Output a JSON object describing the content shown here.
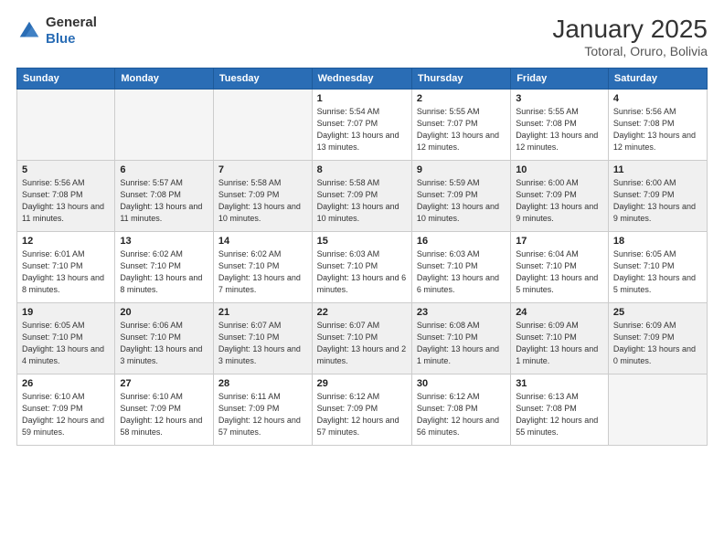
{
  "logo": {
    "general": "General",
    "blue": "Blue"
  },
  "header": {
    "month": "January 2025",
    "location": "Totoral, Oruro, Bolivia"
  },
  "weekdays": [
    "Sunday",
    "Monday",
    "Tuesday",
    "Wednesday",
    "Thursday",
    "Friday",
    "Saturday"
  ],
  "weeks": [
    [
      {
        "day": "",
        "text": ""
      },
      {
        "day": "",
        "text": ""
      },
      {
        "day": "",
        "text": ""
      },
      {
        "day": "1",
        "text": "Sunrise: 5:54 AM\nSunset: 7:07 PM\nDaylight: 13 hours\nand 13 minutes."
      },
      {
        "day": "2",
        "text": "Sunrise: 5:55 AM\nSunset: 7:07 PM\nDaylight: 13 hours\nand 12 minutes."
      },
      {
        "day": "3",
        "text": "Sunrise: 5:55 AM\nSunset: 7:08 PM\nDaylight: 13 hours\nand 12 minutes."
      },
      {
        "day": "4",
        "text": "Sunrise: 5:56 AM\nSunset: 7:08 PM\nDaylight: 13 hours\nand 12 minutes."
      }
    ],
    [
      {
        "day": "5",
        "text": "Sunrise: 5:56 AM\nSunset: 7:08 PM\nDaylight: 13 hours\nand 11 minutes."
      },
      {
        "day": "6",
        "text": "Sunrise: 5:57 AM\nSunset: 7:08 PM\nDaylight: 13 hours\nand 11 minutes."
      },
      {
        "day": "7",
        "text": "Sunrise: 5:58 AM\nSunset: 7:09 PM\nDaylight: 13 hours\nand 10 minutes."
      },
      {
        "day": "8",
        "text": "Sunrise: 5:58 AM\nSunset: 7:09 PM\nDaylight: 13 hours\nand 10 minutes."
      },
      {
        "day": "9",
        "text": "Sunrise: 5:59 AM\nSunset: 7:09 PM\nDaylight: 13 hours\nand 10 minutes."
      },
      {
        "day": "10",
        "text": "Sunrise: 6:00 AM\nSunset: 7:09 PM\nDaylight: 13 hours\nand 9 minutes."
      },
      {
        "day": "11",
        "text": "Sunrise: 6:00 AM\nSunset: 7:09 PM\nDaylight: 13 hours\nand 9 minutes."
      }
    ],
    [
      {
        "day": "12",
        "text": "Sunrise: 6:01 AM\nSunset: 7:10 PM\nDaylight: 13 hours\nand 8 minutes."
      },
      {
        "day": "13",
        "text": "Sunrise: 6:02 AM\nSunset: 7:10 PM\nDaylight: 13 hours\nand 8 minutes."
      },
      {
        "day": "14",
        "text": "Sunrise: 6:02 AM\nSunset: 7:10 PM\nDaylight: 13 hours\nand 7 minutes."
      },
      {
        "day": "15",
        "text": "Sunrise: 6:03 AM\nSunset: 7:10 PM\nDaylight: 13 hours\nand 6 minutes."
      },
      {
        "day": "16",
        "text": "Sunrise: 6:03 AM\nSunset: 7:10 PM\nDaylight: 13 hours\nand 6 minutes."
      },
      {
        "day": "17",
        "text": "Sunrise: 6:04 AM\nSunset: 7:10 PM\nDaylight: 13 hours\nand 5 minutes."
      },
      {
        "day": "18",
        "text": "Sunrise: 6:05 AM\nSunset: 7:10 PM\nDaylight: 13 hours\nand 5 minutes."
      }
    ],
    [
      {
        "day": "19",
        "text": "Sunrise: 6:05 AM\nSunset: 7:10 PM\nDaylight: 13 hours\nand 4 minutes."
      },
      {
        "day": "20",
        "text": "Sunrise: 6:06 AM\nSunset: 7:10 PM\nDaylight: 13 hours\nand 3 minutes."
      },
      {
        "day": "21",
        "text": "Sunrise: 6:07 AM\nSunset: 7:10 PM\nDaylight: 13 hours\nand 3 minutes."
      },
      {
        "day": "22",
        "text": "Sunrise: 6:07 AM\nSunset: 7:10 PM\nDaylight: 13 hours\nand 2 minutes."
      },
      {
        "day": "23",
        "text": "Sunrise: 6:08 AM\nSunset: 7:10 PM\nDaylight: 13 hours\nand 1 minute."
      },
      {
        "day": "24",
        "text": "Sunrise: 6:09 AM\nSunset: 7:10 PM\nDaylight: 13 hours\nand 1 minute."
      },
      {
        "day": "25",
        "text": "Sunrise: 6:09 AM\nSunset: 7:09 PM\nDaylight: 13 hours\nand 0 minutes."
      }
    ],
    [
      {
        "day": "26",
        "text": "Sunrise: 6:10 AM\nSunset: 7:09 PM\nDaylight: 12 hours\nand 59 minutes."
      },
      {
        "day": "27",
        "text": "Sunrise: 6:10 AM\nSunset: 7:09 PM\nDaylight: 12 hours\nand 58 minutes."
      },
      {
        "day": "28",
        "text": "Sunrise: 6:11 AM\nSunset: 7:09 PM\nDaylight: 12 hours\nand 57 minutes."
      },
      {
        "day": "29",
        "text": "Sunrise: 6:12 AM\nSunset: 7:09 PM\nDaylight: 12 hours\nand 57 minutes."
      },
      {
        "day": "30",
        "text": "Sunrise: 6:12 AM\nSunset: 7:08 PM\nDaylight: 12 hours\nand 56 minutes."
      },
      {
        "day": "31",
        "text": "Sunrise: 6:13 AM\nSunset: 7:08 PM\nDaylight: 12 hours\nand 55 minutes."
      },
      {
        "day": "",
        "text": ""
      }
    ]
  ]
}
